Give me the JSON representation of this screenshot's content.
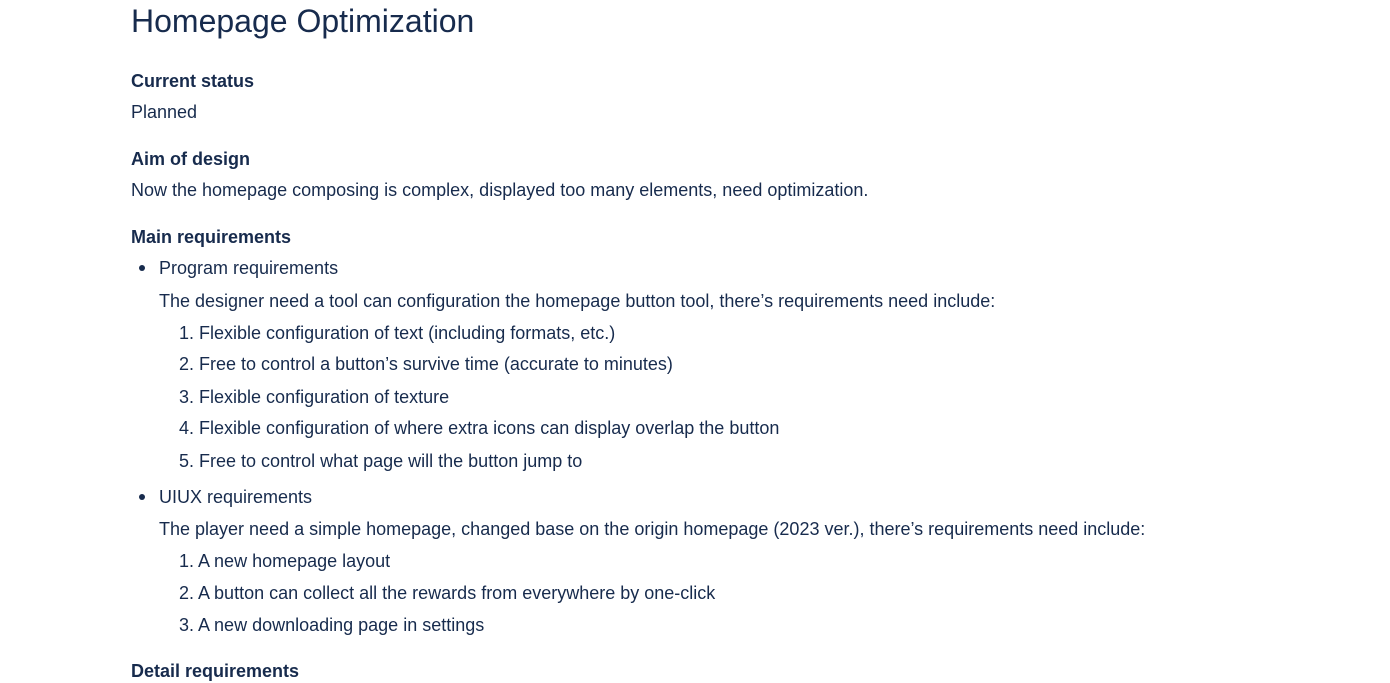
{
  "page": {
    "title": "Homepage Optimization"
  },
  "current_status": {
    "heading": "Current status",
    "value": "Planned"
  },
  "aim": {
    "heading": "Aim of design",
    "text": "Now the homepage composing is complex, displayed too many elements, need optimization."
  },
  "main_requirements": {
    "heading": "Main requirements",
    "groups": [
      {
        "label": "Program requirements",
        "description": "The designer need a tool can configuration the homepage button tool, there’s requirements need include:",
        "items": [
          {
            "num": "1.",
            "text": "Flexible configuration of text (including formats, etc.)"
          },
          {
            "num": "2.",
            "text": "Free to control a button’s survive time (accurate to minutes)"
          },
          {
            "num": "3.",
            "text": "Flexible configuration of texture"
          },
          {
            "num": "4.",
            "text": "Flexible configuration of where extra icons can display overlap the button"
          },
          {
            "num": "5.",
            "text": "Free to control what page will the button jump to"
          }
        ]
      },
      {
        "label": "UIUX requirements",
        "description": "The player need a simple homepage, changed base on the origin homepage (2023 ver.), there’s requirements need include:",
        "items": [
          {
            "num": "1.",
            "text": "A new homepage layout"
          },
          {
            "num": "2.",
            "text": "A button can collect all the rewards from everywhere by one-click"
          },
          {
            "num": "3.",
            "text": "A new downloading page in settings"
          }
        ]
      }
    ]
  },
  "detail_requirements": {
    "heading": "Detail requirements"
  }
}
